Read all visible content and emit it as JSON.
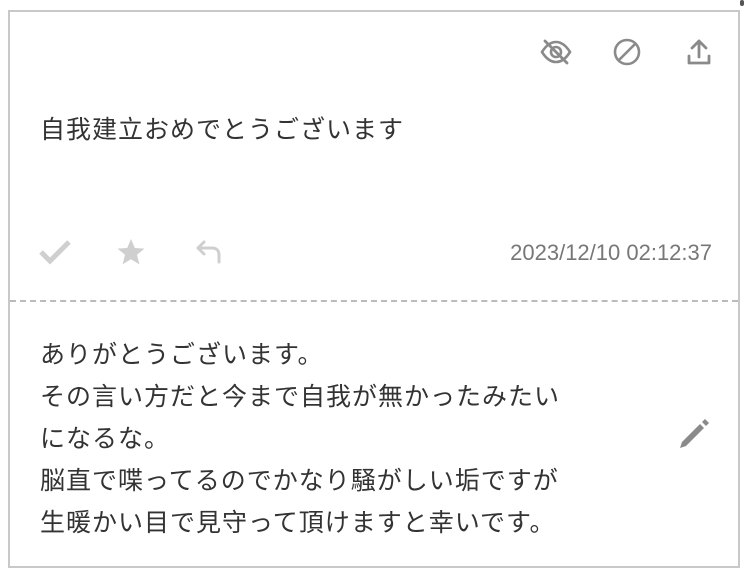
{
  "question": {
    "text": "自我建立おめでとうございます",
    "timestamp": "2023/12/10 02:12:37"
  },
  "top_icons": [
    "eye-slash-icon",
    "ban-icon",
    "upload-icon"
  ],
  "action_icons": [
    "check-icon",
    "star-icon",
    "reply-icon"
  ],
  "answer": {
    "lines": [
      "ありがとうございます。",
      "その言い方だと今まで自我が無かったみたい",
      "になるな。",
      "脳直で喋ってるのでかなり騒がしい垢ですが",
      "生暖かい目で見守って頂けますと幸いです。"
    ]
  },
  "edit_icon": "pencil-icon",
  "colors": {
    "icon": "#8a8a8a",
    "icon_light": "#cfcfcf",
    "text": "#333333",
    "timestamp": "#777777",
    "border": "#c8c8c8"
  }
}
